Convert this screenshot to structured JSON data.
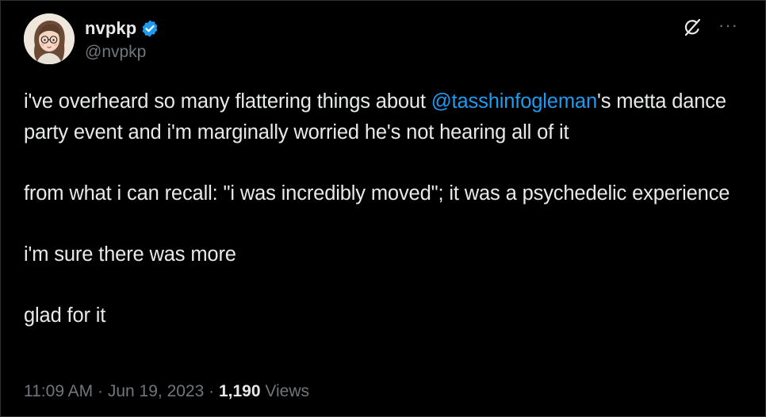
{
  "author": {
    "display_name": "nvpkp",
    "handle": "@nvpkp",
    "verified": true
  },
  "icons": {
    "verified": "verified-badge-icon",
    "grok": "grok-icon",
    "more": "more-icon"
  },
  "colors": {
    "background": "#000000",
    "text": "#e7e9ea",
    "muted": "#71767b",
    "accent": "#1d9bf0"
  },
  "tweet": {
    "p1_before": "i've overheard so many flattering things about ",
    "p1_mention": "@tasshinfogleman",
    "p1_after": "'s metta dance party event and i'm marginally worried he's not hearing all of it",
    "p2": "from what i can recall: \"i was incredibly moved\"; it was a psychedelic experience",
    "p3": "i'm sure there was more",
    "p4": "glad for it"
  },
  "meta": {
    "time": "11:09 AM",
    "separator": " · ",
    "date": "Jun 19, 2023",
    "views_count": "1,190",
    "views_label": " Views"
  },
  "more_glyph": "···"
}
